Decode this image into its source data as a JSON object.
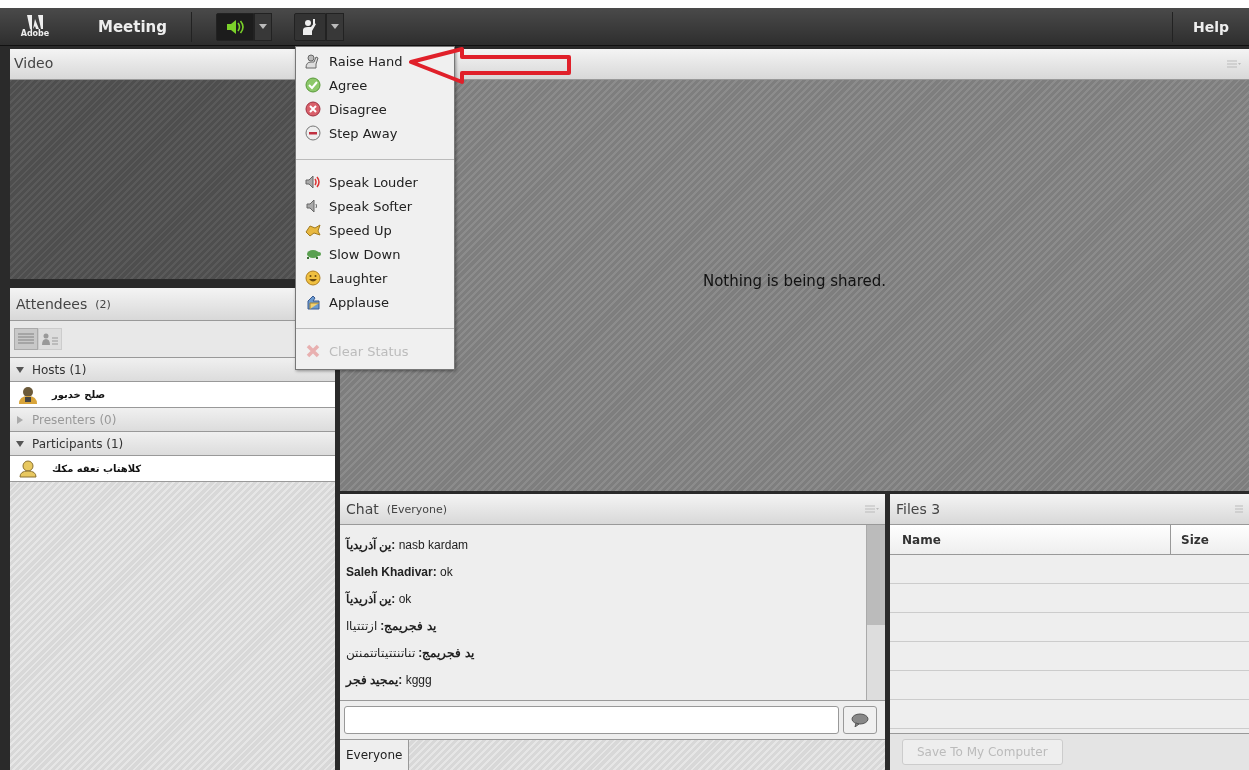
{
  "top_bar": {
    "logo": "Adobe",
    "title": "Meeting",
    "help": "Help"
  },
  "audio_button": {
    "active": true
  },
  "video_pod": {
    "title": "Video"
  },
  "attendees_pod": {
    "title": "Attendees",
    "count": "(2)",
    "view_buttons": [
      {
        "selected": true
      },
      {
        "selected": false
      }
    ],
    "groups": [
      {
        "label": "Hosts (1)",
        "expanded": true,
        "children": [
          {
            "name": "صلح خديور",
            "kind": "host"
          }
        ]
      },
      {
        "label": "Presenters (0)",
        "expanded": false
      },
      {
        "label": "Participants (1)",
        "expanded": true,
        "children": [
          {
            "name": "كلاهتاب تعقه مكك",
            "kind": "participant"
          }
        ]
      }
    ]
  },
  "status_menu": {
    "groups": [
      [
        {
          "label": "Raise Hand",
          "kind": "hand",
          "disabled": false
        },
        {
          "label": "Agree",
          "kind": "agree",
          "disabled": false
        },
        {
          "label": "Disagree",
          "kind": "disagree",
          "disabled": false
        },
        {
          "label": "Step Away",
          "kind": "away",
          "disabled": false
        }
      ],
      [
        {
          "label": "Speak Louder",
          "kind": "louder",
          "disabled": false
        },
        {
          "label": "Speak Softer",
          "kind": "softer",
          "disabled": false
        },
        {
          "label": "Speed Up",
          "kind": "speed",
          "disabled": false
        },
        {
          "label": "Slow Down",
          "kind": "slow",
          "disabled": false
        },
        {
          "label": "Laughter",
          "kind": "laugh",
          "disabled": false
        },
        {
          "label": "Applause",
          "kind": "applause",
          "disabled": false
        }
      ],
      [
        {
          "label": "Clear Status",
          "kind": "clear",
          "disabled": true
        }
      ]
    ]
  },
  "share_pod": {
    "message": "Nothing is being shared."
  },
  "chat_pod": {
    "title": "Chat",
    "scope": "(Everyone)",
    "messages": [
      {
        "sender": "ین آذریدیآ:",
        "text": "nasb kardam"
      },
      {
        "sender": "Saleh Khadivar:",
        "text": "ok"
      },
      {
        "sender": "ین آذریدیآ:",
        "text": "ok"
      },
      {
        "sender": "ید فجریمج:",
        "text": "ازتتتیاا"
      },
      {
        "sender": "ید فجریمج:",
        "text": "تناتنتتیتاتتمنتن"
      },
      {
        "sender": "یمجید فجر:",
        "text": "kggg"
      }
    ],
    "tabs": [
      {
        "label": "Everyone",
        "selected": true
      }
    ]
  },
  "files_pod": {
    "title": "Files 3",
    "columns": [
      "Name",
      "Size"
    ],
    "save_button": {
      "label": "Save To My Computer",
      "disabled": true
    }
  }
}
